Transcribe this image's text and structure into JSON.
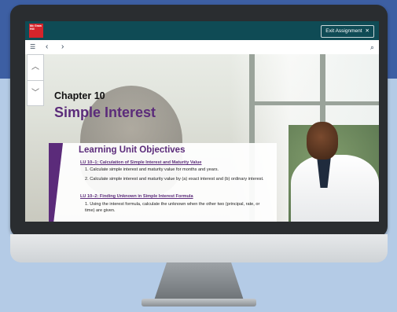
{
  "app": {
    "logo_text": "Mc Graw Hill",
    "exit_label": "Exit Assignment",
    "exit_icon": "close-icon"
  },
  "toolbar": {
    "icons": [
      "list-icon",
      "chevron-left-icon",
      "chevron-right-icon",
      "search-icon"
    ]
  },
  "side_controls": {
    "icons": [
      "chevron-up-icon",
      "chevron-down-icon"
    ]
  },
  "page": {
    "chapter_label": "Chapter 10",
    "chapter_title": "Simple Interest",
    "objectives_title": "Learning Unit Objectives",
    "units": [
      {
        "heading": "LU 10–1: Calculation of Simple Interest and Maturity Value",
        "items": [
          "1. Calculate simple interest and maturity value for months and years.",
          "2. Calculate simple interest and maturity value by (a) exact interest and (b) ordinary interest."
        ]
      },
      {
        "heading": "LU 10–2: Finding Unknown in Simple Interest Formula",
        "items": [
          "1. Using the interest formula, calculate the unknown when the other two (principal, rate, or time) are given."
        ]
      }
    ]
  },
  "colors": {
    "topbar": "#0f4b55",
    "brand_red": "#d4242b",
    "accent_purple": "#5b2b7a"
  }
}
